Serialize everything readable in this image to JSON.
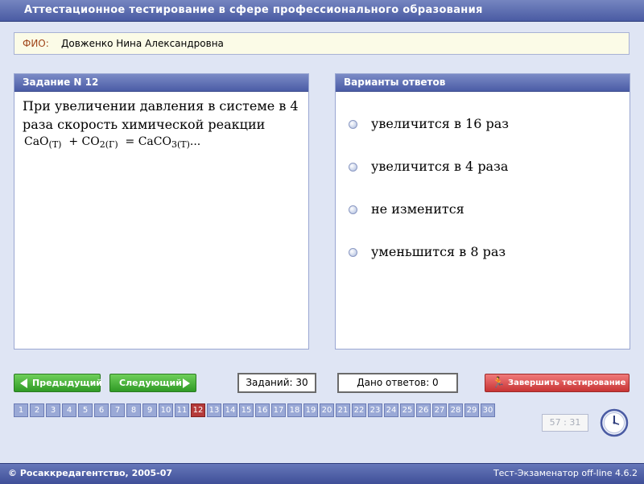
{
  "app": {
    "title": "Аттестационное тестирование в сфере профессионального образования"
  },
  "student": {
    "label": "ФИО:",
    "name": "Довженко Нина Александровна"
  },
  "task_panel": {
    "header": "Задание N 12",
    "question": "При увеличении давления в системе в 4 раза скорость химической реакции",
    "formula": {
      "cao": "CaO",
      "cao_sub": "(Т)",
      "plus": "+ CO",
      "co2_sub": "2(Г)",
      "eq": "= CaCO",
      "caco3_sub": "3(Т)",
      "tail": "..."
    }
  },
  "answers_panel": {
    "header": "Варианты ответов",
    "options": [
      {
        "text": "увеличится в 16 раз"
      },
      {
        "text": "увеличится в 4 раза"
      },
      {
        "text": "не изменится"
      },
      {
        "text": "уменьшится в 8 раз"
      }
    ]
  },
  "controls": {
    "prev_label": "Предыдущий",
    "next_label": "Следующий",
    "tasks_count": "Заданий: 30",
    "answered_count": "Дано ответов: 0",
    "finish_label": "Завершить тестирование"
  },
  "question_nav": {
    "current": 12,
    "numbers": [
      "1",
      "2",
      "3",
      "4",
      "5",
      "6",
      "7",
      "8",
      "9",
      "10",
      "11",
      "12",
      "13",
      "14",
      "15",
      "16",
      "17",
      "18",
      "19",
      "20",
      "21",
      "22",
      "23",
      "24",
      "25",
      "26",
      "27",
      "28",
      "29",
      "30"
    ]
  },
  "timer": "57 : 31",
  "footer": {
    "copyright": "© Росаккредагентство, 2005-07",
    "version": "Тест-Экзаменатор off-line 4.6.2"
  },
  "icons": {
    "prev": "arrow-left-icon",
    "next": "arrow-right-icon",
    "finish": "running-man-icon",
    "clock": "clock-icon",
    "radio": "radio-button"
  },
  "colors": {
    "background": "#dfe5f4",
    "header_bar": "#4a5ba3",
    "nav_green": "#2f9a25",
    "finish_red": "#c83434",
    "active_question": "#b53a3a",
    "question_button": "#9aa9d6",
    "fio_label": "#a0451a"
  }
}
